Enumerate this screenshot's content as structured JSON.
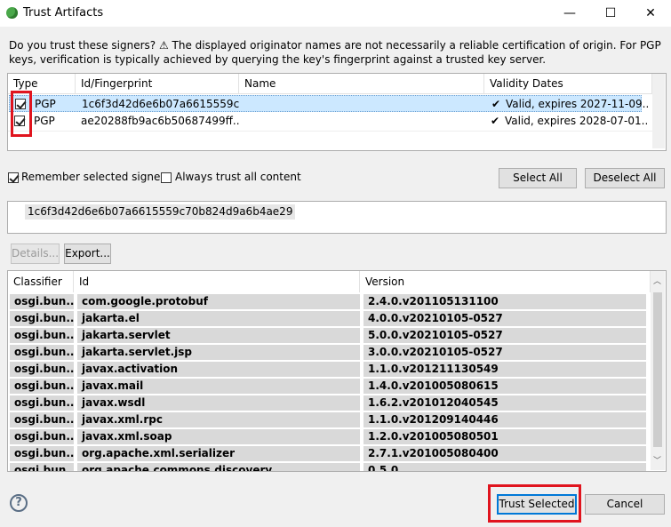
{
  "window": {
    "title": "Trust Artifacts",
    "minimize": "—",
    "maximize": "☐",
    "close": "✕"
  },
  "intro": "Do you trust these signers?  ⚠ The displayed originator names are not necessarily a reliable certification of origin.  For PGP keys, verification is typically achieved by querying the key's fingerprint against a trusted key server.",
  "signers_table": {
    "headers": [
      "Type",
      "Id/Fingerprint",
      "Name",
      "Validity Dates"
    ],
    "rows": [
      {
        "checked": true,
        "type": "PGP",
        "fingerprint": "1c6f3d42d6e6b07a6615559c...",
        "name": "",
        "validity": "Valid, expires 2027-11-09..."
      },
      {
        "checked": true,
        "type": "PGP",
        "fingerprint": "ae20288fb9ac6b50687499ff...",
        "name": "",
        "validity": "Valid, expires 2028-07-01..."
      }
    ]
  },
  "options": {
    "remember_label": "Remember selected signers",
    "always_trust_label": "Always trust all content"
  },
  "buttons": {
    "select_all": "Select All",
    "deselect_all": "Deselect All",
    "details": "Details...",
    "export": "Export...",
    "trust_selected": "Trust Selected",
    "cancel": "Cancel"
  },
  "fingerprint_full": "1c6f3d42d6e6b07a6615559c70b824d9a6b4ae29",
  "artifacts_table": {
    "headers": [
      "Classifier",
      "Id",
      "Version"
    ],
    "rows": [
      {
        "classifier": "osgi.bun...",
        "id": "com.google.protobuf",
        "version": "2.4.0.v201105131100"
      },
      {
        "classifier": "osgi.bun...",
        "id": "jakarta.el",
        "version": "4.0.0.v20210105-0527"
      },
      {
        "classifier": "osgi.bun...",
        "id": "jakarta.servlet",
        "version": "5.0.0.v20210105-0527"
      },
      {
        "classifier": "osgi.bun...",
        "id": "jakarta.servlet.jsp",
        "version": "3.0.0.v20210105-0527"
      },
      {
        "classifier": "osgi.bun...",
        "id": "javax.activation",
        "version": "1.1.0.v201211130549"
      },
      {
        "classifier": "osgi.bun...",
        "id": "javax.mail",
        "version": "1.4.0.v201005080615"
      },
      {
        "classifier": "osgi.bun...",
        "id": "javax.wsdl",
        "version": "1.6.2.v201012040545"
      },
      {
        "classifier": "osgi.bun...",
        "id": "javax.xml.rpc",
        "version": "1.1.0.v201209140446"
      },
      {
        "classifier": "osgi.bun...",
        "id": "javax.xml.soap",
        "version": "1.2.0.v201005080501"
      },
      {
        "classifier": "osgi.bun...",
        "id": "org.apache.xml.serializer",
        "version": "2.7.1.v201005080400"
      },
      {
        "classifier": "osgi.bun...",
        "id": "org.apache.commons.discovery",
        "version": "0.5.0..."
      }
    ]
  },
  "help": "?",
  "colors": {
    "selection": "#cce8ff",
    "row_gray": "#d9d9d9",
    "highlight_red": "#e0141e",
    "accent": "#0078d7"
  }
}
